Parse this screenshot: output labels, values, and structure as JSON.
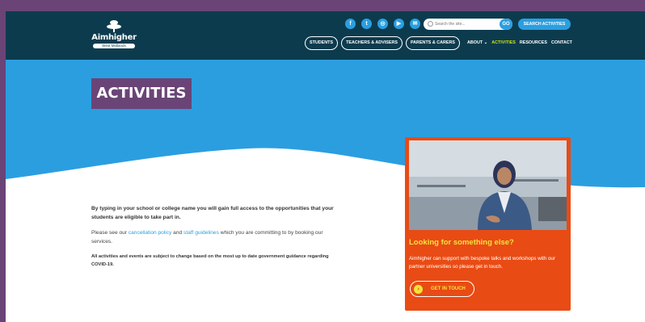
{
  "brand": {
    "name": "Aimhigher",
    "region": "West Midlands"
  },
  "header": {
    "socials": [
      {
        "icon": "facebook-icon",
        "glyph": "f"
      },
      {
        "icon": "twitter-icon",
        "glyph": "t"
      },
      {
        "icon": "instagram-icon",
        "glyph": "◎"
      },
      {
        "icon": "youtube-icon",
        "glyph": "▶"
      },
      {
        "icon": "email-icon",
        "glyph": "✉"
      }
    ],
    "search": {
      "placeholder": "Search the site...",
      "go_label": "GO"
    },
    "search_activities_label": "SEARCH ACTIVITIES"
  },
  "nav": {
    "pills": [
      "STUDENTS",
      "TEACHERS & ADVISERS",
      "PARENTS & CARERS"
    ],
    "about": "ABOUT",
    "activities": "ACTIVITIES",
    "resources": "RESOURCES",
    "contact": "CONTACT"
  },
  "page": {
    "title": "ACTIVITIES"
  },
  "content": {
    "intro": "By typing in your school or college name you will gain full access to the opportunities that your students are eligible to take part in.",
    "policy_before": "Please see our ",
    "policy_link1": "cancellation policy",
    "policy_mid": " and ",
    "policy_link2": "staff guidelines",
    "policy_after": " which you are committing to by booking our services.",
    "notice": "All activities and events are subject to change based on the most up to date government guidance regarding COVID-19."
  },
  "card": {
    "title": "Looking for something else?",
    "text": "Aimhigher can support with bespoke talks and workshops with our partner universities so please get in touch.",
    "button": "GET IN TOUCH"
  },
  "colors": {
    "header_bg": "#0d3b4e",
    "hero_blue": "#2b9ee0",
    "purple": "#6a4477",
    "orange": "#e94b14",
    "yellow": "#f2e33a",
    "active_green": "#c8e21c"
  }
}
